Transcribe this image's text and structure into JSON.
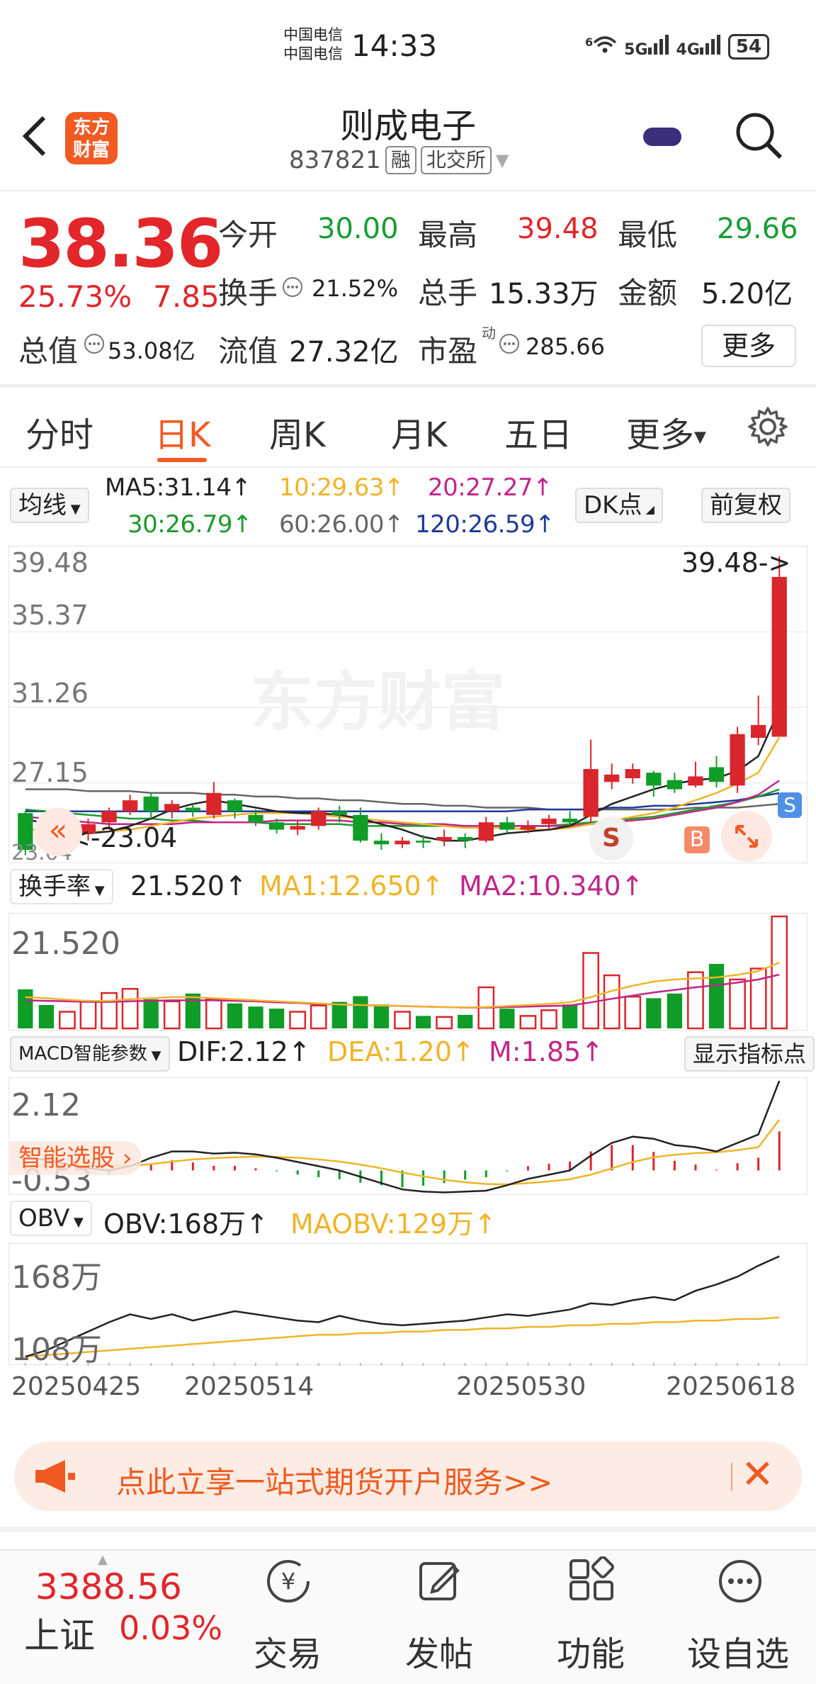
{
  "status_bar": {
    "carrier1": "中国电信",
    "carrier2": "中国电信",
    "time": "14:33",
    "signal_text": "6",
    "net1": "5G",
    "net2": "4G",
    "battery": "54"
  },
  "header": {
    "logo_line1": "东方",
    "logo_line2": "财富",
    "title": "则成电子",
    "code": "837821",
    "tag_margin": "融",
    "tag_exchange": "北交所"
  },
  "quote": {
    "price": "38.36",
    "change_pct": "25.73%",
    "change": "7.85",
    "open_label": "今开",
    "open": "30.00",
    "high_label": "最高",
    "high": "39.48",
    "low_label": "最低",
    "low": "29.66",
    "turnover_label": "换手",
    "turnover": "21.52%",
    "volume_label": "总手",
    "volume": "15.33万",
    "amount_label": "金额",
    "amount": "5.20亿",
    "mcap_label": "总值",
    "mcap": "53.08亿",
    "float_label": "流值",
    "float_cap": "27.32亿",
    "pe_label": "市盈",
    "pe_sup": "动",
    "pe": "285.66",
    "more": "更多"
  },
  "tabs": [
    "分时",
    "日K",
    "周K",
    "月K",
    "五日",
    "更多"
  ],
  "ma": {
    "selector": "均线",
    "ma5": "MA5:31.14↑",
    "ma10": "10:29.63↑",
    "ma20": "20:27.27↑",
    "ma30": "30:26.79↑",
    "ma60": "60:26.00↑",
    "ma120": "120:26.59↑",
    "dk": "DK点",
    "adj": "前复权",
    "color5": "#222222",
    "color10": "#f0b429",
    "color20": "#c2258a",
    "color30": "#1b9a2a",
    "color60": "#666666",
    "color120": "#1f3a9b"
  },
  "kchart": {
    "y1": "39.48",
    "y2": "35.37",
    "y3": "31.26",
    "y4": "27.15",
    "y5": "23.04",
    "high_mark": "39.48->",
    "low_mark": "<-23.04",
    "watermark": "东方财富",
    "sig_s": "S",
    "sig_b": "B",
    "sig_s2": "S"
  },
  "turnover": {
    "selector": "换手率",
    "value": "21.520↑",
    "ma1": "MA1:12.650↑",
    "ma2": "MA2:10.340↑",
    "axis": "21.520"
  },
  "macd": {
    "selector": "MACD智能参数",
    "dif": "DIF:2.12↑",
    "dea": "DEA:1.20↑",
    "m": "M:1.85↑",
    "show_btn": "显示指标点",
    "axis_top": "2.12",
    "axis_bottom": "-0.53",
    "smart_pick": "智能选股 ›"
  },
  "obv": {
    "selector": "OBV",
    "obv": "OBV:168万↑",
    "maobv": "MAOBV:129万↑",
    "axis_top": "168万",
    "axis_bottom": "108万"
  },
  "dates": [
    "20250425",
    "20250514",
    "20250530",
    "20250618"
  ],
  "banner": {
    "text": "点此立享一站式期货开户服务>>"
  },
  "bottom": {
    "index_value": "3388.56",
    "index_name": "上证",
    "index_change": "0.03%",
    "nav": [
      "交易",
      "发帖",
      "功能",
      "设自选"
    ]
  },
  "chart_data": {
    "type": "candlestick",
    "price_range": [
      23.04,
      39.48
    ],
    "candles": [
      [
        25.5,
        23.5,
        25.6,
        23.2
      ],
      [
        24.2,
        24.0,
        24.8,
        23.4
      ],
      [
        24.0,
        24.2,
        24.6,
        23.6
      ],
      [
        24.4,
        24.9,
        25.2,
        24.0
      ],
      [
        25.0,
        25.6,
        25.8,
        24.6
      ],
      [
        25.6,
        26.2,
        26.5,
        25.4
      ],
      [
        26.4,
        25.6,
        26.6,
        25.2
      ],
      [
        25.6,
        26.0,
        26.2,
        25.2
      ],
      [
        25.8,
        25.6,
        26.0,
        25.3
      ],
      [
        25.4,
        26.6,
        27.2,
        25.2
      ],
      [
        26.2,
        25.6,
        26.3,
        25.2
      ],
      [
        25.4,
        25.0,
        25.7,
        24.8
      ],
      [
        25.0,
        24.6,
        25.2,
        24.4
      ],
      [
        24.6,
        24.8,
        25.1,
        24.3
      ],
      [
        24.8,
        25.6,
        25.8,
        24.6
      ],
      [
        25.6,
        25.4,
        25.9,
        25.0
      ],
      [
        25.4,
        24.0,
        25.8,
        23.9
      ],
      [
        24.0,
        23.8,
        24.4,
        23.5
      ],
      [
        23.8,
        24.0,
        24.2,
        23.6
      ],
      [
        24.0,
        23.9,
        24.3,
        23.6
      ],
      [
        24.0,
        24.2,
        24.6,
        23.7
      ],
      [
        24.2,
        24.0,
        24.4,
        23.6
      ],
      [
        24.0,
        25.0,
        25.3,
        23.9
      ],
      [
        25.0,
        24.6,
        25.3,
        24.4
      ],
      [
        24.6,
        24.8,
        25.1,
        24.4
      ],
      [
        24.9,
        25.2,
        25.4,
        24.6
      ],
      [
        25.2,
        25.0,
        25.6,
        24.8
      ],
      [
        25.3,
        27.9,
        29.5,
        25.0
      ],
      [
        27.2,
        27.6,
        28.2,
        26.8
      ],
      [
        27.4,
        27.9,
        28.2,
        27.1
      ],
      [
        27.7,
        27.0,
        27.8,
        26.4
      ],
      [
        27.3,
        26.8,
        27.7,
        26.6
      ],
      [
        27.0,
        27.5,
        28.3,
        26.9
      ],
      [
        28.0,
        27.2,
        28.6,
        26.9
      ],
      [
        27.0,
        29.8,
        30.2,
        26.6
      ],
      [
        29.6,
        30.3,
        31.9,
        29.2
      ],
      [
        29.66,
        38.36,
        39.48,
        29.66
      ]
    ],
    "ma5": [
      25.2,
      24.9,
      24.6,
      24.4,
      24.5,
      24.8,
      25.2,
      25.7,
      26.0,
      26.2,
      26.0,
      25.8,
      25.6,
      25.5,
      25.5,
      25.4,
      25.2,
      24.9,
      24.6,
      24.2,
      24.0,
      24.0,
      24.2,
      24.4,
      24.5,
      24.6,
      24.8,
      25.4,
      26.0,
      26.4,
      26.8,
      27.1,
      27.3,
      27.4,
      27.8,
      28.6,
      31.14
    ],
    "ma10": [
      24.6,
      24.6,
      24.5,
      24.5,
      24.5,
      24.6,
      24.8,
      25.0,
      25.2,
      25.3,
      25.4,
      25.5,
      25.5,
      25.5,
      25.4,
      25.3,
      25.2,
      25.1,
      25.0,
      24.9,
      24.8,
      24.7,
      24.7,
      24.7,
      24.6,
      24.6,
      24.7,
      24.9,
      25.1,
      25.3,
      25.5,
      25.8,
      26.2,
      26.6,
      27.1,
      27.7,
      29.63
    ],
    "ma20": [
      25.3,
      25.2,
      25.1,
      25.0,
      24.9,
      24.9,
      24.9,
      24.9,
      25.0,
      25.0,
      25.0,
      25.0,
      25.1,
      25.1,
      25.1,
      25.1,
      25.0,
      25.0,
      24.9,
      24.9,
      24.9,
      24.8,
      24.8,
      24.8,
      24.8,
      24.8,
      24.8,
      24.9,
      25.0,
      25.1,
      25.2,
      25.4,
      25.6,
      25.8,
      26.1,
      26.5,
      27.27
    ],
    "ma30": [
      25.7,
      25.6,
      25.5,
      25.4,
      25.3,
      25.2,
      25.2,
      25.1,
      25.1,
      25.0,
      25.0,
      25.0,
      24.9,
      24.9,
      24.9,
      24.9,
      24.8,
      24.8,
      24.8,
      24.8,
      24.8,
      24.8,
      24.8,
      24.8,
      24.8,
      24.8,
      24.9,
      25.0,
      25.1,
      25.2,
      25.3,
      25.5,
      25.7,
      25.9,
      26.1,
      26.4,
      26.79
    ],
    "ma60": [
      26.8,
      26.8,
      26.8,
      26.7,
      26.7,
      26.7,
      26.6,
      26.6,
      26.6,
      26.5,
      26.5,
      26.4,
      26.4,
      26.3,
      26.3,
      26.2,
      26.2,
      26.1,
      26.0,
      26.0,
      25.9,
      25.9,
      25.8,
      25.8,
      25.8,
      25.7,
      25.7,
      25.7,
      25.7,
      25.7,
      25.7,
      25.7,
      25.8,
      25.8,
      25.8,
      25.9,
      26.0
    ],
    "ma120": [
      25.6,
      25.6,
      25.6,
      25.6,
      25.6,
      25.6,
      25.6,
      25.6,
      25.6,
      25.6,
      25.6,
      25.6,
      25.6,
      25.6,
      25.6,
      25.6,
      25.6,
      25.6,
      25.6,
      25.6,
      25.6,
      25.6,
      25.6,
      25.6,
      25.7,
      25.7,
      25.7,
      25.7,
      25.8,
      25.8,
      25.9,
      25.9,
      26.0,
      26.1,
      26.2,
      26.4,
      26.59
    ],
    "turnover_range": [
      0,
      21.52
    ],
    "turnover": [
      7.5,
      4.5,
      3.2,
      5.2,
      6.8,
      7.6,
      5.6,
      5.2,
      6.7,
      5.6,
      4.8,
      4.2,
      3.8,
      3.2,
      4.4,
      5.1,
      6.2,
      4.6,
      3.2,
      2.4,
      2.2,
      2.6,
      7.9,
      3.8,
      2.4,
      3.5,
      4.6,
      14.5,
      10.2,
      6.1,
      5.8,
      6.7,
      10.8,
      12.4,
      9.4,
      11.5,
      21.52
    ],
    "turnover_ma1": [
      6.0,
      5.8,
      5.5,
      5.3,
      5.3,
      5.6,
      5.8,
      6.0,
      6.0,
      5.8,
      5.6,
      5.4,
      5.2,
      5.0,
      4.8,
      4.6,
      4.5,
      4.4,
      4.3,
      4.2,
      4.1,
      4.0,
      4.1,
      4.3,
      4.5,
      4.7,
      5.0,
      6.0,
      7.2,
      8.2,
      9.0,
      9.4,
      9.6,
      9.8,
      10.3,
      11.0,
      12.65
    ],
    "turnover_ma2": [
      5.4,
      5.3,
      5.2,
      5.1,
      5.1,
      5.2,
      5.3,
      5.4,
      5.4,
      5.4,
      5.3,
      5.2,
      5.0,
      4.9,
      4.7,
      4.6,
      4.5,
      4.4,
      4.3,
      4.2,
      4.1,
      4.0,
      4.0,
      4.1,
      4.2,
      4.3,
      4.4,
      5.0,
      5.7,
      6.3,
      6.9,
      7.4,
      7.9,
      8.3,
      8.8,
      9.4,
      10.34
    ],
    "macd_range": [
      -0.53,
      2.12
    ],
    "dif": [
      0.3,
      0.25,
      0.15,
      0.05,
      0.0,
      0.1,
      0.3,
      0.45,
      0.45,
      0.4,
      0.42,
      0.38,
      0.3,
      0.2,
      0.1,
      0.0,
      -0.15,
      -0.3,
      -0.45,
      -0.5,
      -0.52,
      -0.5,
      -0.48,
      -0.35,
      -0.2,
      -0.1,
      0.0,
      0.35,
      0.65,
      0.8,
      0.75,
      0.6,
      0.55,
      0.45,
      0.65,
      0.85,
      2.12
    ],
    "dea": [
      0.1,
      0.12,
      0.13,
      0.12,
      0.11,
      0.11,
      0.15,
      0.21,
      0.26,
      0.29,
      0.31,
      0.33,
      0.32,
      0.3,
      0.26,
      0.21,
      0.14,
      0.05,
      -0.05,
      -0.14,
      -0.22,
      -0.28,
      -0.32,
      -0.33,
      -0.3,
      -0.26,
      -0.21,
      -0.1,
      0.05,
      0.2,
      0.31,
      0.37,
      0.41,
      0.43,
      0.48,
      0.55,
      1.2
    ],
    "macd_hist": [
      0.4,
      0.26,
      0.04,
      -0.14,
      -0.22,
      -0.02,
      0.3,
      0.48,
      0.38,
      0.22,
      0.22,
      0.1,
      -0.04,
      -0.2,
      -0.32,
      -0.42,
      -0.58,
      -0.7,
      -0.8,
      -0.72,
      -0.6,
      -0.44,
      -0.32,
      -0.04,
      0.2,
      0.32,
      0.42,
      0.9,
      1.2,
      1.2,
      0.88,
      0.46,
      0.28,
      0.04,
      0.34,
      0.6,
      1.85
    ],
    "obv_range": [
      100,
      175
    ],
    "obv": [
      104,
      108,
      114,
      120,
      126,
      131,
      128,
      131,
      127,
      130,
      133,
      131,
      129,
      127,
      126,
      130,
      127,
      125,
      124,
      125,
      126,
      127,
      129,
      131,
      130,
      132,
      134,
      138,
      137,
      140,
      142,
      140,
      146,
      150,
      155,
      162,
      168
    ],
    "maobv": [
      104,
      105,
      106,
      107,
      108,
      109,
      110,
      111,
      112,
      113,
      114,
      115,
      116,
      117,
      118,
      118,
      119,
      119,
      120,
      120,
      121,
      121,
      122,
      122,
      123,
      123,
      124,
      124,
      125,
      125,
      126,
      126,
      127,
      127,
      128,
      128,
      129
    ]
  }
}
